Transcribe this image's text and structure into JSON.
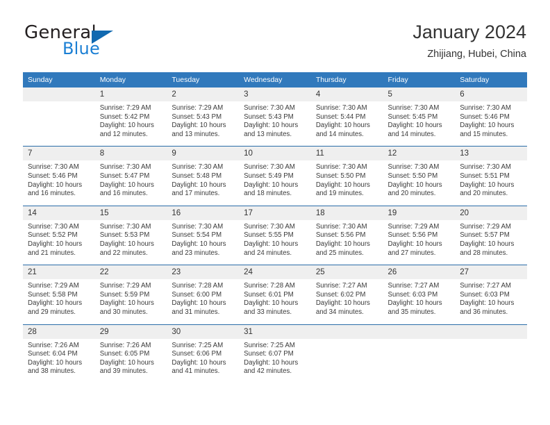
{
  "brand": {
    "line1": "General",
    "line2": "Blue",
    "triangle_color": "#1169b0",
    "blue_color": "#1b7fd4"
  },
  "header": {
    "title": "January 2024",
    "subtitle": "Zhijiang, Hubei, China"
  },
  "theme": {
    "header_bg": "#3179bc",
    "divider": "#2a6ca8",
    "daynum_bg": "#efefef"
  },
  "weekday_headers": [
    "Sunday",
    "Monday",
    "Tuesday",
    "Wednesday",
    "Thursday",
    "Friday",
    "Saturday"
  ],
  "labels": {
    "sunrise_prefix": "Sunrise:",
    "sunset_prefix": "Sunset:",
    "daylight_prefix": "Daylight:"
  },
  "weeks": [
    [
      {
        "day": "",
        "empty": true
      },
      {
        "day": "1",
        "sunrise": "Sunrise: 7:29 AM",
        "sunset": "Sunset: 5:42 PM",
        "daylight1": "Daylight: 10 hours",
        "daylight2": "and 12 minutes."
      },
      {
        "day": "2",
        "sunrise": "Sunrise: 7:29 AM",
        "sunset": "Sunset: 5:43 PM",
        "daylight1": "Daylight: 10 hours",
        "daylight2": "and 13 minutes."
      },
      {
        "day": "3",
        "sunrise": "Sunrise: 7:30 AM",
        "sunset": "Sunset: 5:43 PM",
        "daylight1": "Daylight: 10 hours",
        "daylight2": "and 13 minutes."
      },
      {
        "day": "4",
        "sunrise": "Sunrise: 7:30 AM",
        "sunset": "Sunset: 5:44 PM",
        "daylight1": "Daylight: 10 hours",
        "daylight2": "and 14 minutes."
      },
      {
        "day": "5",
        "sunrise": "Sunrise: 7:30 AM",
        "sunset": "Sunset: 5:45 PM",
        "daylight1": "Daylight: 10 hours",
        "daylight2": "and 14 minutes."
      },
      {
        "day": "6",
        "sunrise": "Sunrise: 7:30 AM",
        "sunset": "Sunset: 5:46 PM",
        "daylight1": "Daylight: 10 hours",
        "daylight2": "and 15 minutes."
      }
    ],
    [
      {
        "day": "7",
        "sunrise": "Sunrise: 7:30 AM",
        "sunset": "Sunset: 5:46 PM",
        "daylight1": "Daylight: 10 hours",
        "daylight2": "and 16 minutes."
      },
      {
        "day": "8",
        "sunrise": "Sunrise: 7:30 AM",
        "sunset": "Sunset: 5:47 PM",
        "daylight1": "Daylight: 10 hours",
        "daylight2": "and 16 minutes."
      },
      {
        "day": "9",
        "sunrise": "Sunrise: 7:30 AM",
        "sunset": "Sunset: 5:48 PM",
        "daylight1": "Daylight: 10 hours",
        "daylight2": "and 17 minutes."
      },
      {
        "day": "10",
        "sunrise": "Sunrise: 7:30 AM",
        "sunset": "Sunset: 5:49 PM",
        "daylight1": "Daylight: 10 hours",
        "daylight2": "and 18 minutes."
      },
      {
        "day": "11",
        "sunrise": "Sunrise: 7:30 AM",
        "sunset": "Sunset: 5:50 PM",
        "daylight1": "Daylight: 10 hours",
        "daylight2": "and 19 minutes."
      },
      {
        "day": "12",
        "sunrise": "Sunrise: 7:30 AM",
        "sunset": "Sunset: 5:50 PM",
        "daylight1": "Daylight: 10 hours",
        "daylight2": "and 20 minutes."
      },
      {
        "day": "13",
        "sunrise": "Sunrise: 7:30 AM",
        "sunset": "Sunset: 5:51 PM",
        "daylight1": "Daylight: 10 hours",
        "daylight2": "and 20 minutes."
      }
    ],
    [
      {
        "day": "14",
        "sunrise": "Sunrise: 7:30 AM",
        "sunset": "Sunset: 5:52 PM",
        "daylight1": "Daylight: 10 hours",
        "daylight2": "and 21 minutes."
      },
      {
        "day": "15",
        "sunrise": "Sunrise: 7:30 AM",
        "sunset": "Sunset: 5:53 PM",
        "daylight1": "Daylight: 10 hours",
        "daylight2": "and 22 minutes."
      },
      {
        "day": "16",
        "sunrise": "Sunrise: 7:30 AM",
        "sunset": "Sunset: 5:54 PM",
        "daylight1": "Daylight: 10 hours",
        "daylight2": "and 23 minutes."
      },
      {
        "day": "17",
        "sunrise": "Sunrise: 7:30 AM",
        "sunset": "Sunset: 5:55 PM",
        "daylight1": "Daylight: 10 hours",
        "daylight2": "and 24 minutes."
      },
      {
        "day": "18",
        "sunrise": "Sunrise: 7:30 AM",
        "sunset": "Sunset: 5:56 PM",
        "daylight1": "Daylight: 10 hours",
        "daylight2": "and 25 minutes."
      },
      {
        "day": "19",
        "sunrise": "Sunrise: 7:29 AM",
        "sunset": "Sunset: 5:56 PM",
        "daylight1": "Daylight: 10 hours",
        "daylight2": "and 27 minutes."
      },
      {
        "day": "20",
        "sunrise": "Sunrise: 7:29 AM",
        "sunset": "Sunset: 5:57 PM",
        "daylight1": "Daylight: 10 hours",
        "daylight2": "and 28 minutes."
      }
    ],
    [
      {
        "day": "21",
        "sunrise": "Sunrise: 7:29 AM",
        "sunset": "Sunset: 5:58 PM",
        "daylight1": "Daylight: 10 hours",
        "daylight2": "and 29 minutes."
      },
      {
        "day": "22",
        "sunrise": "Sunrise: 7:29 AM",
        "sunset": "Sunset: 5:59 PM",
        "daylight1": "Daylight: 10 hours",
        "daylight2": "and 30 minutes."
      },
      {
        "day": "23",
        "sunrise": "Sunrise: 7:28 AM",
        "sunset": "Sunset: 6:00 PM",
        "daylight1": "Daylight: 10 hours",
        "daylight2": "and 31 minutes."
      },
      {
        "day": "24",
        "sunrise": "Sunrise: 7:28 AM",
        "sunset": "Sunset: 6:01 PM",
        "daylight1": "Daylight: 10 hours",
        "daylight2": "and 33 minutes."
      },
      {
        "day": "25",
        "sunrise": "Sunrise: 7:27 AM",
        "sunset": "Sunset: 6:02 PM",
        "daylight1": "Daylight: 10 hours",
        "daylight2": "and 34 minutes."
      },
      {
        "day": "26",
        "sunrise": "Sunrise: 7:27 AM",
        "sunset": "Sunset: 6:03 PM",
        "daylight1": "Daylight: 10 hours",
        "daylight2": "and 35 minutes."
      },
      {
        "day": "27",
        "sunrise": "Sunrise: 7:27 AM",
        "sunset": "Sunset: 6:03 PM",
        "daylight1": "Daylight: 10 hours",
        "daylight2": "and 36 minutes."
      }
    ],
    [
      {
        "day": "28",
        "sunrise": "Sunrise: 7:26 AM",
        "sunset": "Sunset: 6:04 PM",
        "daylight1": "Daylight: 10 hours",
        "daylight2": "and 38 minutes."
      },
      {
        "day": "29",
        "sunrise": "Sunrise: 7:26 AM",
        "sunset": "Sunset: 6:05 PM",
        "daylight1": "Daylight: 10 hours",
        "daylight2": "and 39 minutes."
      },
      {
        "day": "30",
        "sunrise": "Sunrise: 7:25 AM",
        "sunset": "Sunset: 6:06 PM",
        "daylight1": "Daylight: 10 hours",
        "daylight2": "and 41 minutes."
      },
      {
        "day": "31",
        "sunrise": "Sunrise: 7:25 AM",
        "sunset": "Sunset: 6:07 PM",
        "daylight1": "Daylight: 10 hours",
        "daylight2": "and 42 minutes."
      },
      {
        "day": "",
        "empty": true
      },
      {
        "day": "",
        "empty": true
      },
      {
        "day": "",
        "empty": true
      }
    ]
  ]
}
